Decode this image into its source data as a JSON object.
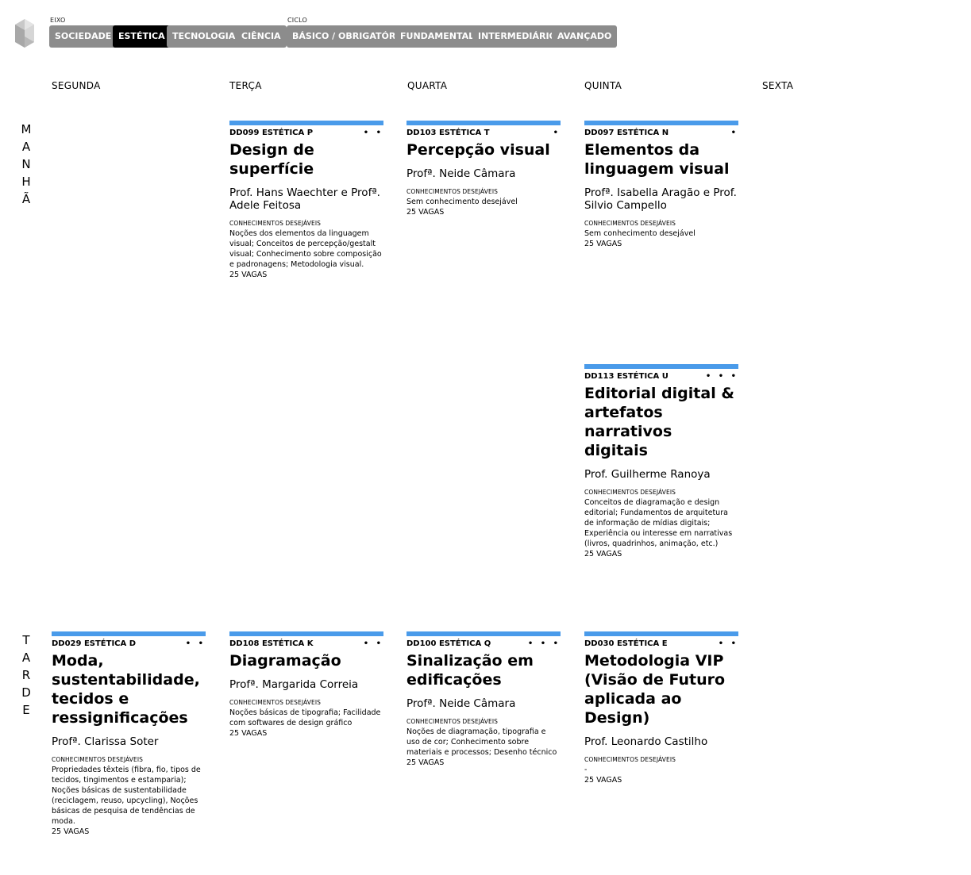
{
  "filters": {
    "eixo_label": "EIXO",
    "ciclo_label": "CICLO",
    "eixo": [
      "SOCIEDADE",
      "ESTÉTICA",
      "TECNOLOGIA",
      "CIÊNCIA"
    ],
    "ciclo": [
      "BÁSICO / OBRIGATÓRIO",
      "FUNDAMENTAL",
      "INTERMEDIÁRIO",
      "AVANÇADO"
    ],
    "active": "ESTÉTICA"
  },
  "days": [
    "SEGUNDA",
    "TERÇA",
    "QUARTA",
    "QUINTA",
    "SEXTA"
  ],
  "periods": {
    "morning": "MANHÃ",
    "afternoon": "TARDE"
  },
  "colors": {
    "accent": "#4a9bea",
    "chip": "#8c8c8c",
    "chip_active": "#000000"
  },
  "cards": [
    {
      "code": "DD099 ESTÉTICA P",
      "dots": "• •",
      "title": "Design de superfície",
      "prof": "Prof. Hans Waechter e Profª. Adele Feitosa",
      "knowledge_label": "CONHECIMENTOS DESEJÁVEIS",
      "knowledge": "Noções dos elementos da linguagem visual; Conceitos de percepção/gestalt visual; Conhecimento sobre composição e padronagens; Metodologia visual.",
      "vagas": "25 VAGAS"
    },
    {
      "code": "DD103 ESTÉTICA T",
      "dots": "•",
      "title": "Percepção visual",
      "prof": "Profª. Neide Câmara",
      "knowledge_label": "CONHECIMENTOS DESEJÁVEIS",
      "knowledge": "Sem conhecimento desejável",
      "vagas": "25 VAGAS"
    },
    {
      "code": "DD097 ESTÉTICA N",
      "dots": "•",
      "title": "Elementos da linguagem visual",
      "prof": "Profª. Isabella Aragão e Prof. Silvio Campello",
      "knowledge_label": "CONHECIMENTOS DESEJÁVEIS",
      "knowledge": "Sem conhecimento desejável",
      "vagas": "25 VAGAS"
    },
    {
      "code": "DD113 ESTÉTICA U",
      "dots": "• • •",
      "title": "Editorial digital & artefatos narrativos digitais",
      "prof": "Prof. Guilherme Ranoya",
      "knowledge_label": "CONHECIMENTOS DESEJÁVEIS",
      "knowledge": "Conceitos de diagramação e design editorial; Fundamentos de arquitetura de informação de mídias digitais; Experiência ou interesse em narrativas (livros, quadrinhos, animação, etc.)",
      "vagas": "25 VAGAS"
    },
    {
      "code": "DD029 ESTÉTICA D",
      "dots": "• •",
      "title": "Moda, sustentabilidade, tecidos e ressignificações",
      "prof": "Profª. Clarissa Soter",
      "knowledge_label": "CONHECIMENTOS DESEJÁVEIS",
      "knowledge": "Propriedades têxteis (fibra, fio, tipos de tecidos, tingimentos e estamparia); Noções básicas de sustentabilidade (reciclagem, reuso, upcycling), Noções básicas de pesquisa de tendências de moda.",
      "vagas": "25 VAGAS"
    },
    {
      "code": "DD108 ESTÉTICA K",
      "dots": "• •",
      "title": "Diagramação",
      "prof": "Profª. Margarida Correia",
      "knowledge_label": "CONHECIMENTOS DESEJÁVEIS",
      "knowledge": "Noções básicas de tipografia; Facilidade com softwares de design gráfico",
      "vagas": "25 VAGAS"
    },
    {
      "code": "DD100 ESTÉTICA Q",
      "dots": "• • •",
      "title": "Sinalização em edificações",
      "prof": "Profª. Neide Câmara",
      "knowledge_label": "CONHECIMENTOS DESEJÁVEIS",
      "knowledge": "Noções de diagramação, tipografia e uso de cor; Conhecimento sobre materiais e processos; Desenho técnico",
      "vagas": "25 VAGAS"
    },
    {
      "code": "DD030 ESTÉTICA E",
      "dots": "• •",
      "title": "Metodologia VIP (Visão de Futuro aplicada ao Design)",
      "prof": "Prof. Leonardo Castilho",
      "knowledge_label": "CONHECIMENTOS DESEJÁVEIS",
      "knowledge": "-",
      "vagas": "25 VAGAS"
    }
  ]
}
